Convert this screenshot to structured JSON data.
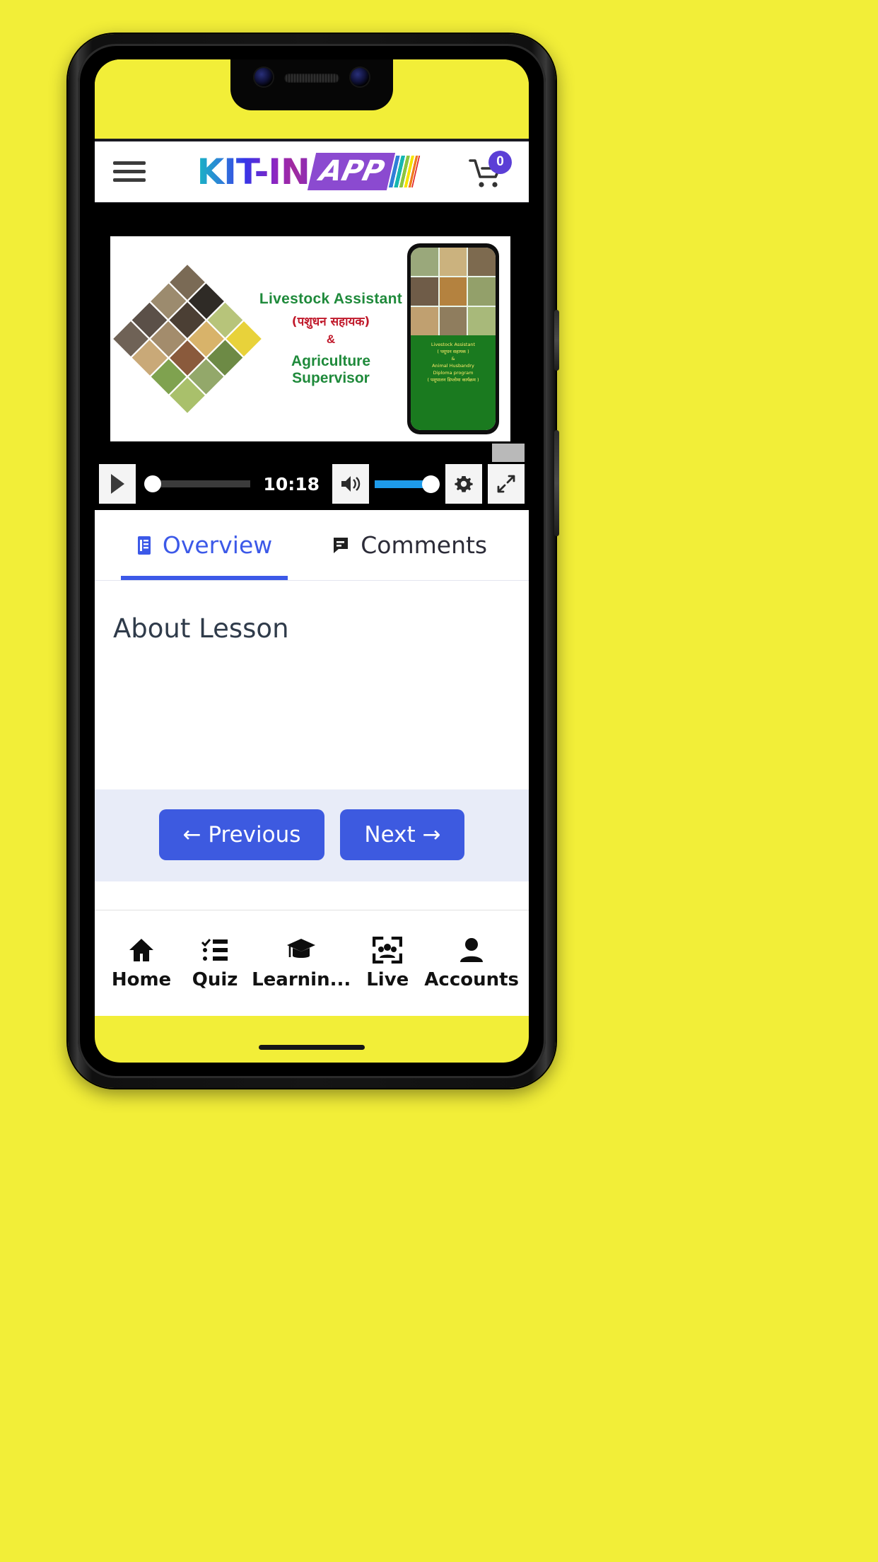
{
  "page": {
    "background_color": "#f2ee38"
  },
  "header": {
    "menu_icon": "hamburger-menu-icon",
    "logo_main": "KIT-IN",
    "logo_badge": "APP",
    "cart_icon": "shopping-cart-icon",
    "cart_count": "0",
    "cart_badge_color": "#5b3fd6"
  },
  "video": {
    "slide": {
      "title_en": "Livestock Assistant",
      "title_hi": "(पशुधन  सहायक)",
      "amp": "&",
      "subtitle_en": "Agriculture Supervisor",
      "phone_mock_text": "Livestock Assistant\n( पशुधन सहायक )\n&\nAnimal Husbandry\nDiploma program\n( पशुपालन डिप्लोमा कार्यक्रम )"
    },
    "controls": {
      "play_icon": "play-icon",
      "time": "10:18",
      "volume_icon": "volume-high-icon",
      "settings_icon": "gear-icon",
      "fullscreen_icon": "fullscreen-icon",
      "progress_percent": 0,
      "volume_percent": 100,
      "volume_fill_color": "#1e9bea"
    }
  },
  "tabs": [
    {
      "label": "Overview",
      "icon": "document-icon",
      "active": true
    },
    {
      "label": "Comments",
      "icon": "comment-icon",
      "active": false
    }
  ],
  "content": {
    "about_heading": "About Lesson"
  },
  "lesson_nav": {
    "previous_label": "← Previous",
    "next_label": "Next →",
    "button_color": "#3d5ae0"
  },
  "bottom_nav": [
    {
      "label": "Home",
      "icon": "home-icon"
    },
    {
      "label": "Quiz",
      "icon": "checklist-icon"
    },
    {
      "label": "Learnin...",
      "icon": "graduation-cap-icon"
    },
    {
      "label": "Live",
      "icon": "live-group-icon"
    },
    {
      "label": "Accounts",
      "icon": "person-icon"
    }
  ]
}
